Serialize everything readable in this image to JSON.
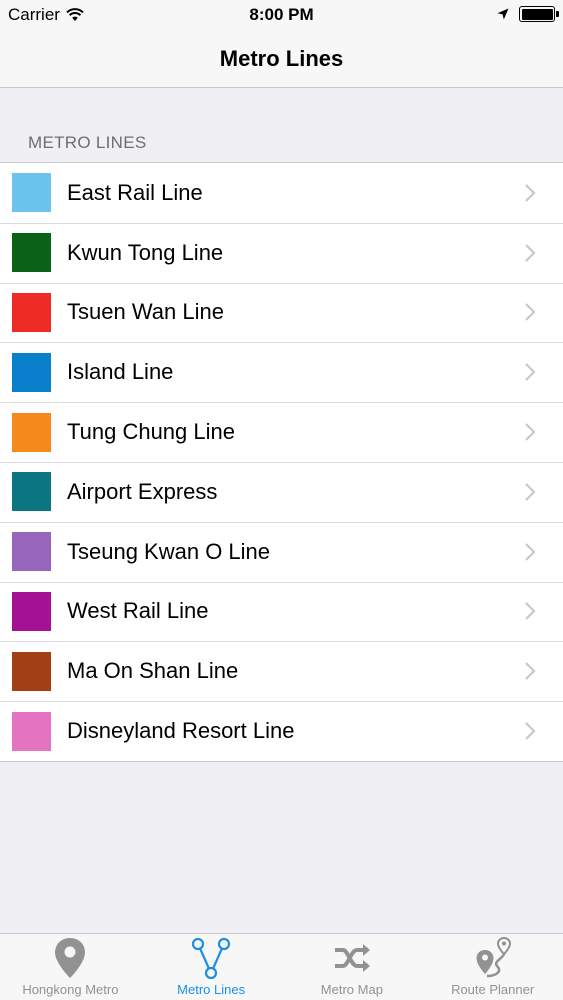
{
  "status_bar": {
    "carrier": "Carrier",
    "time": "8:00 PM",
    "battery_level": 1.0
  },
  "nav": {
    "title": "Metro Lines"
  },
  "section": {
    "header": "METRO LINES"
  },
  "lines": [
    {
      "name": "East Rail Line",
      "color": "#6ac4ee"
    },
    {
      "name": "Kwun Tong Line",
      "color": "#0a6216"
    },
    {
      "name": "Tsuen Wan Line",
      "color": "#ef2b25"
    },
    {
      "name": "Island Line",
      "color": "#0a7fcb"
    },
    {
      "name": "Tung Chung Line",
      "color": "#f5891b"
    },
    {
      "name": "Airport Express",
      "color": "#0b7581"
    },
    {
      "name": "Tseung Kwan O Line",
      "color": "#9865bc"
    },
    {
      "name": "West Rail Line",
      "color": "#a41193"
    },
    {
      "name": "Ma On Shan Line",
      "color": "#a23f14"
    },
    {
      "name": "Disneyland Resort Line",
      "color": "#e474c2"
    }
  ],
  "tabs": [
    {
      "label": "Hongkong Metro",
      "icon": "location-pin-icon",
      "active": false
    },
    {
      "label": "Metro Lines",
      "icon": "metro-lines-icon",
      "active": true
    },
    {
      "label": "Metro Map",
      "icon": "shuffle-icon",
      "active": false
    },
    {
      "label": "Route Planner",
      "icon": "route-planner-icon",
      "active": false
    }
  ],
  "colors": {
    "accent": "#1a8fe8",
    "inactive_tab": "#929292",
    "background": "#efeff4"
  }
}
